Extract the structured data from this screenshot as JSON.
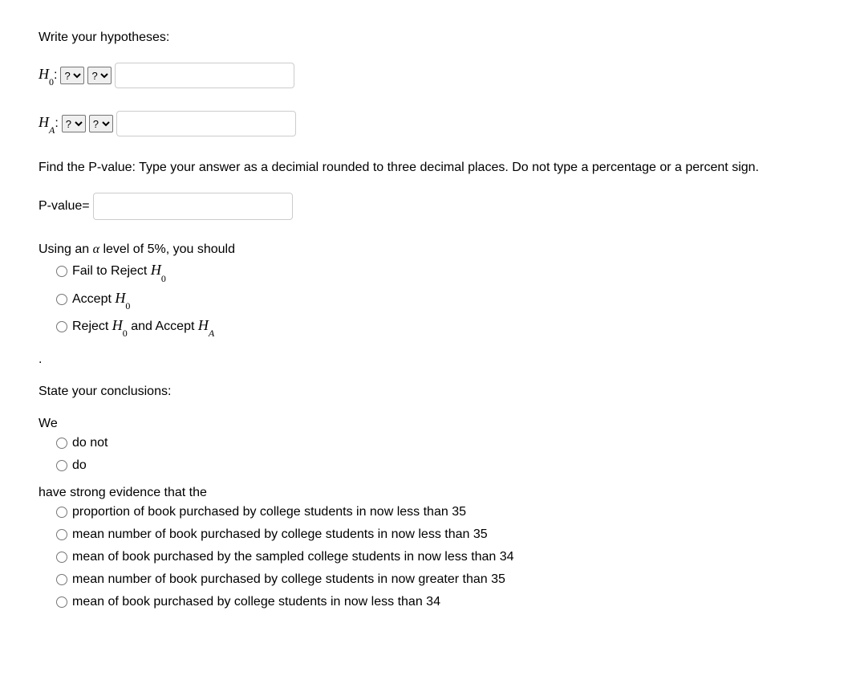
{
  "hypotheses": {
    "heading": "Write your hypotheses:",
    "h0_label_sym": "H",
    "h0_label_sub": "0",
    "h0_colon": ":",
    "ha_label_sym": "H",
    "ha_label_sub": "A",
    "ha_colon": ":",
    "select_placeholder": "?"
  },
  "pvalue": {
    "instruction": "Find the P-value: Type your answer as a decimial rounded to three decimal places. Do not type a percentage or a percent sign.",
    "label": "P-value="
  },
  "alpha_q": {
    "prefix": "Using an ",
    "alpha_sym": "α",
    "middle": " level of ",
    "percent_text": "5%",
    "suffix": ", you should",
    "options": [
      {
        "prefix": "Fail to Reject ",
        "sym": "H",
        "sub": "0",
        "suffix": ""
      },
      {
        "prefix": "Accept ",
        "sym": "H",
        "sub": "0",
        "suffix": ""
      },
      {
        "prefix": "Reject ",
        "sym": "H",
        "sub": "0",
        "mid": " and Accept ",
        "sym2": "H",
        "sub2": "A",
        "suffix": ""
      }
    ]
  },
  "dot": ".",
  "conclusions": {
    "heading": "State your conclusions:",
    "we": "We",
    "q1_options": [
      "do not",
      "do"
    ],
    "evidence": "have strong evidence that the",
    "q2_options": [
      "proportion of book purchased by college students in now less than 35",
      "mean number of book purchased by college students in now less than 35",
      "mean of book purchased by the sampled college students in now less than 34",
      "mean number of book purchased by college students in now greater than 35",
      "mean of book purchased by college students in now less than 34"
    ]
  }
}
